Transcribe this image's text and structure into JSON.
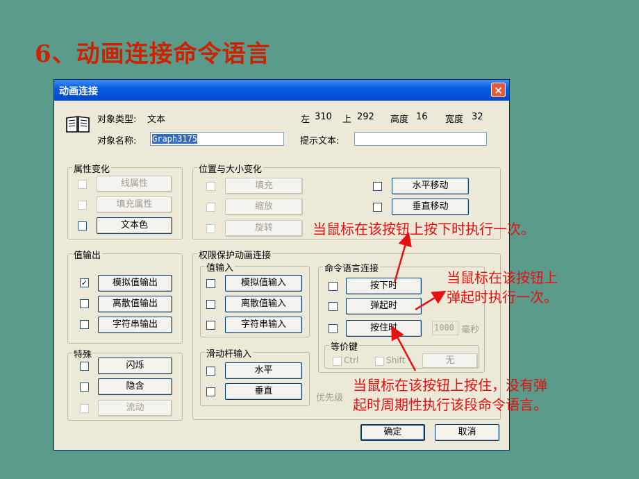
{
  "slide_title": "6、动画连接命令语言",
  "dialog": {
    "title": "动画连接",
    "close": "×",
    "object_type_label": "对象类型:",
    "object_type_value": "文本",
    "object_name_label": "对象名称:",
    "object_name_value": "Graph3175",
    "left_label": "左",
    "left_value": "310",
    "top_label": "上",
    "top_value": "292",
    "height_label": "高度",
    "height_value": "16",
    "width_label": "宽度",
    "width_value": "32",
    "tip_label": "提示文本:",
    "tip_value": ""
  },
  "attr_group": {
    "caption": "属性变化",
    "items": [
      {
        "label": "线属性",
        "enabled": false
      },
      {
        "label": "填充属性",
        "enabled": false
      },
      {
        "label": "文本色",
        "enabled": true
      }
    ]
  },
  "pos_group": {
    "caption": "位置与大小变化",
    "left_items": [
      {
        "label": "填充",
        "enabled": false
      },
      {
        "label": "缩放",
        "enabled": false
      },
      {
        "label": "旋转",
        "enabled": false
      }
    ],
    "right_items": [
      {
        "label": "水平移动",
        "enabled": true
      },
      {
        "label": "垂直移动",
        "enabled": true
      }
    ]
  },
  "value_output": {
    "caption": "值输出",
    "items": [
      {
        "label": "模拟值输出",
        "checked": true
      },
      {
        "label": "离散值输出",
        "checked": false
      },
      {
        "label": "字符串输出",
        "checked": false
      }
    ]
  },
  "special": {
    "caption": "特殊",
    "items": [
      {
        "label": "闪烁",
        "enabled": true
      },
      {
        "label": "隐含",
        "enabled": true
      },
      {
        "label": "流动",
        "enabled": false
      }
    ]
  },
  "protect_group": {
    "caption": "权限保护动画连接",
    "value_input": {
      "caption": "值输入",
      "items": [
        "模拟值输入",
        "离散值输入",
        "字符串输入"
      ]
    },
    "slider": {
      "caption": "滑动杆输入",
      "items": [
        "水平",
        "垂直"
      ]
    },
    "command": {
      "caption": "命令语言连接",
      "items": [
        "按下时",
        "弹起时",
        "按住时"
      ],
      "interval_value": "1000",
      "interval_unit": "毫秒",
      "equiv": {
        "caption": "等价键",
        "ctrl": "Ctrl",
        "shift": "Shift",
        "key_value": "无"
      }
    },
    "priority_label": "优先级"
  },
  "buttons": {
    "ok": "确定",
    "cancel": "取消"
  },
  "annotations": {
    "press": "当鼠标在该按钮上按下时执行一次。",
    "release_1": "当鼠标在该按钮上",
    "release_2": "弹起时执行一次。",
    "hold_1": "当鼠标在该按钮上按住，没有弹",
    "hold_2": "起时周期性执行该段命令语言。"
  },
  "colors": {
    "annotation": "#e61010",
    "title": "#cc2200",
    "background": "#5b9b8c"
  }
}
